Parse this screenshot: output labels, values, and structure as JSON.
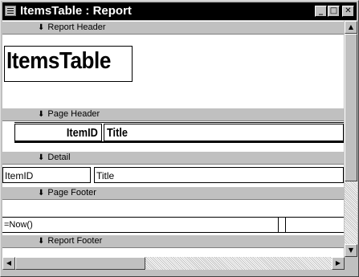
{
  "window": {
    "title": "ItemsTable : Report",
    "minimize_glyph": "_",
    "maximize_glyph": "□",
    "close_glyph": "✕"
  },
  "sections": {
    "report_header": "Report Header",
    "page_header": "Page Header",
    "detail": "Detail",
    "page_footer": "Page Footer",
    "report_footer": "Report Footer"
  },
  "report_header": {
    "title_label": "ItemsTable"
  },
  "page_header": {
    "itemid_label": "ItemID",
    "title_label": "Title"
  },
  "detail": {
    "itemid_field": "ItemID",
    "title_field": "Title"
  },
  "page_footer": {
    "expression": "=Now()"
  },
  "scrollbars": {
    "up_glyph": "▲",
    "down_glyph": "▼",
    "left_glyph": "◀",
    "right_glyph": "▶"
  },
  "icons": {
    "band_arrow": "🡇"
  },
  "colors": {
    "titlebar": "#000000",
    "band": "#c0c0c0",
    "design_surface": "#ffffff"
  }
}
